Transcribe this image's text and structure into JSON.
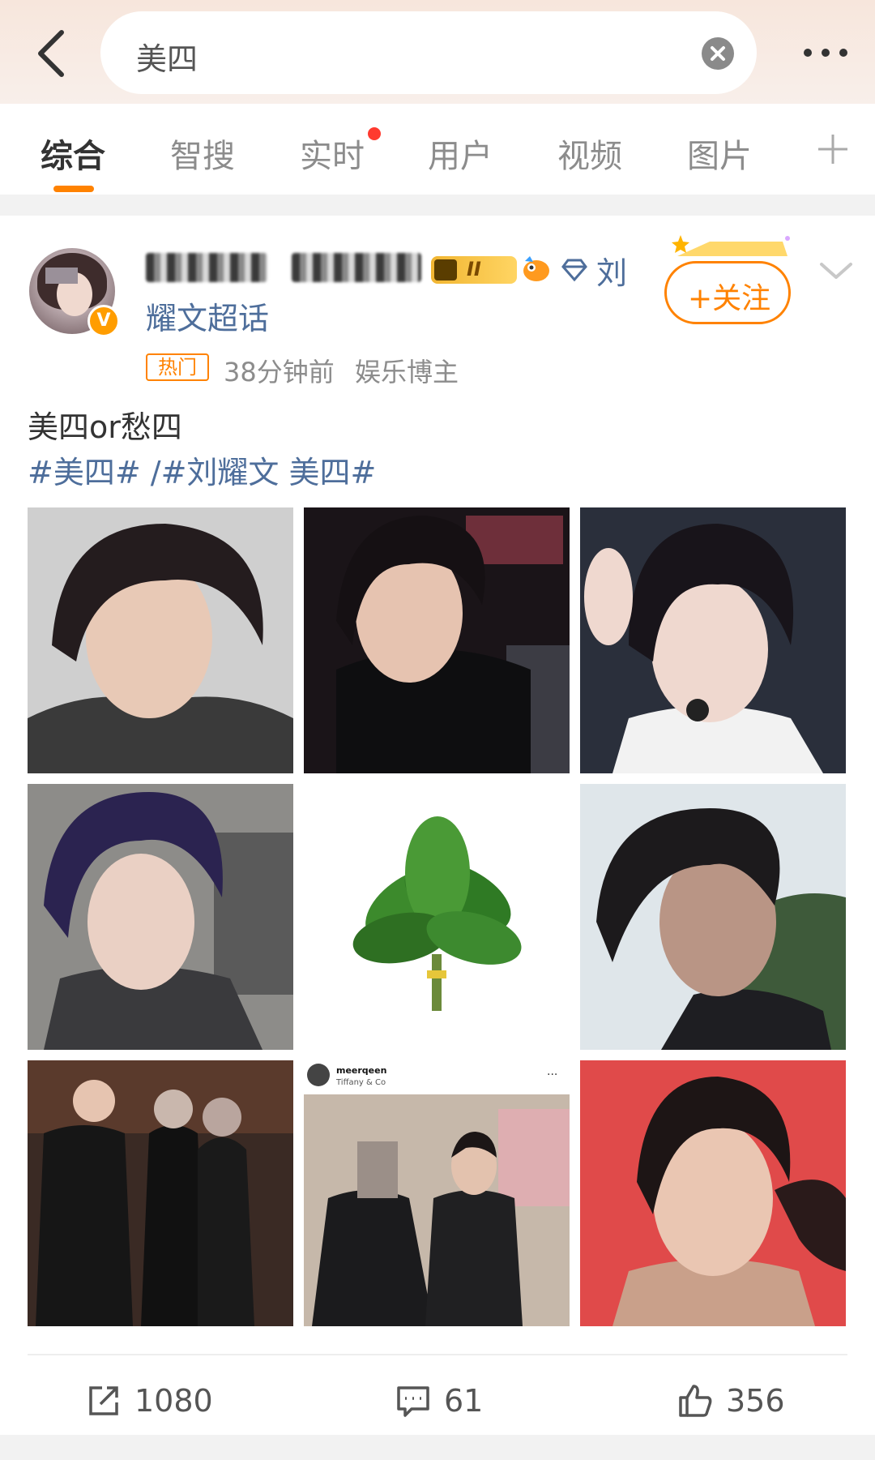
{
  "search": {
    "query": "美四"
  },
  "tabs": [
    {
      "label": "综合",
      "active": true
    },
    {
      "label": "智搜"
    },
    {
      "label": "实时",
      "badge": "red-dot"
    },
    {
      "label": "用户"
    },
    {
      "label": "视频"
    },
    {
      "label": "图片"
    }
  ],
  "post": {
    "author": {
      "name_suffix": "刘",
      "super_topic_line2": "耀文超话",
      "level_badge": "II",
      "verified_badge": "V"
    },
    "follow_label": "+关注",
    "hot_badge": "热门",
    "time": "38分钟前",
    "source": "娱乐博主",
    "text": "美四or愁四",
    "hashtags": [
      "#美四#",
      "/",
      "#刘耀文 美四#"
    ],
    "images": [
      {
        "name": "photo-1"
      },
      {
        "name": "photo-2"
      },
      {
        "name": "photo-3"
      },
      {
        "name": "photo-4"
      },
      {
        "name": "photo-5"
      },
      {
        "name": "photo-6"
      },
      {
        "name": "photo-7"
      },
      {
        "name": "photo-8",
        "overlay_user": "meerqeen",
        "overlay_sub": "Tiffany & Co"
      },
      {
        "name": "photo-9"
      }
    ],
    "actions": {
      "repost_count": "1080",
      "comment_count": "61",
      "like_count": "356"
    }
  },
  "colors": {
    "accent": "#ff8200",
    "link": "#4e6e9b",
    "red_dot": "#ff3a2f"
  }
}
